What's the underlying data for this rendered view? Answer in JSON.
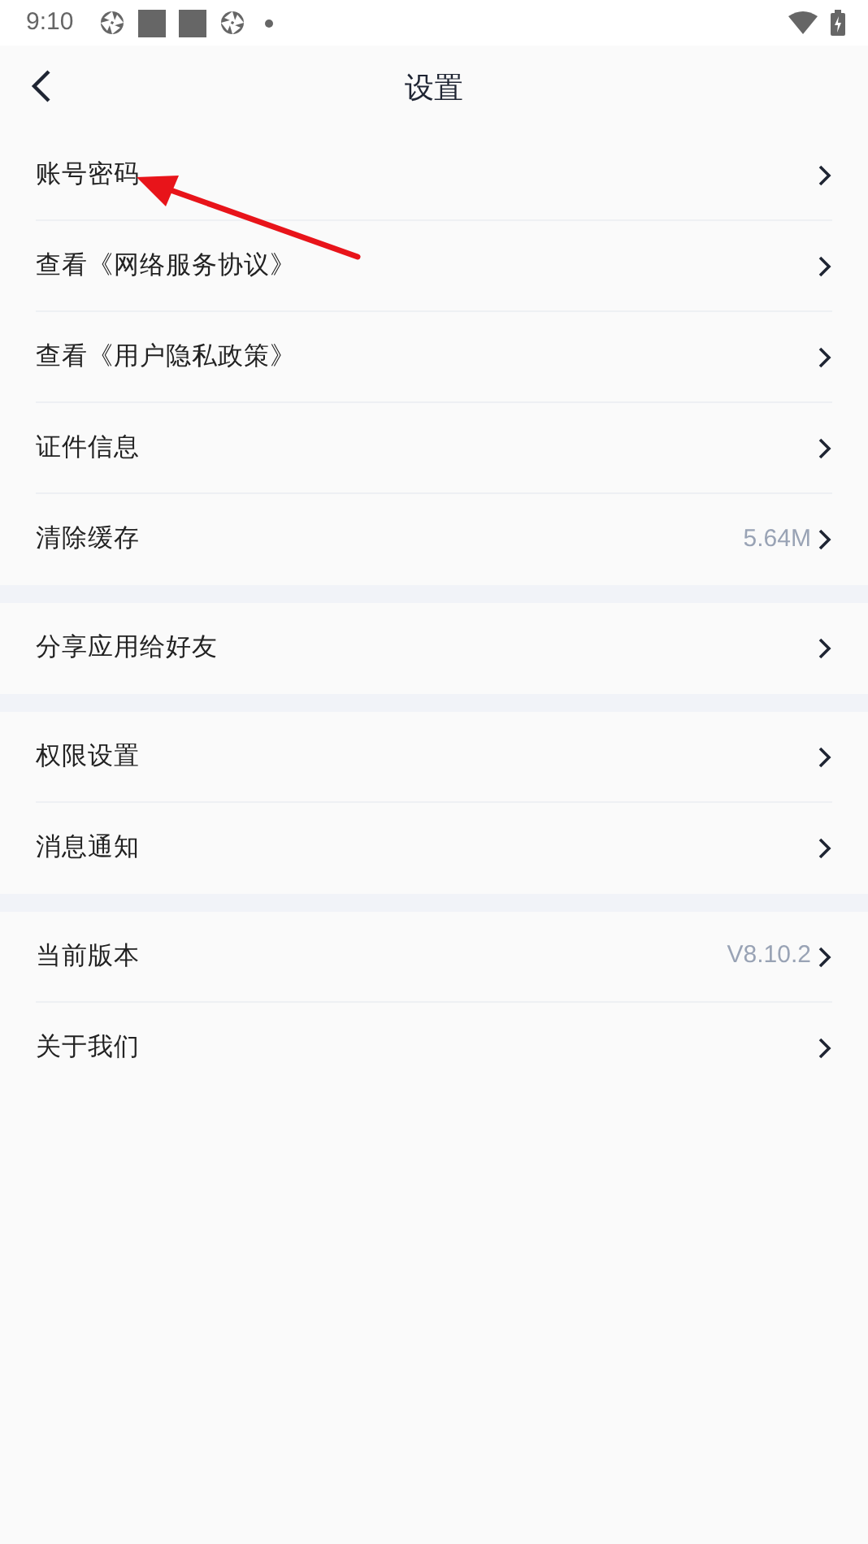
{
  "status_bar": {
    "time": "9:10"
  },
  "header": {
    "title": "设置"
  },
  "groups": [
    {
      "items": [
        {
          "label": "账号密码"
        },
        {
          "label": "查看《网络服务协议》"
        },
        {
          "label": "查看《用户隐私政策》"
        },
        {
          "label": "证件信息"
        },
        {
          "label": "清除缓存",
          "value": "5.64M"
        }
      ]
    },
    {
      "items": [
        {
          "label": "分享应用给好友"
        }
      ]
    },
    {
      "items": [
        {
          "label": "权限设置"
        },
        {
          "label": "消息通知"
        }
      ]
    },
    {
      "items": [
        {
          "label": "当前版本",
          "value": "V8.10.2"
        },
        {
          "label": "关于我们"
        }
      ]
    }
  ]
}
